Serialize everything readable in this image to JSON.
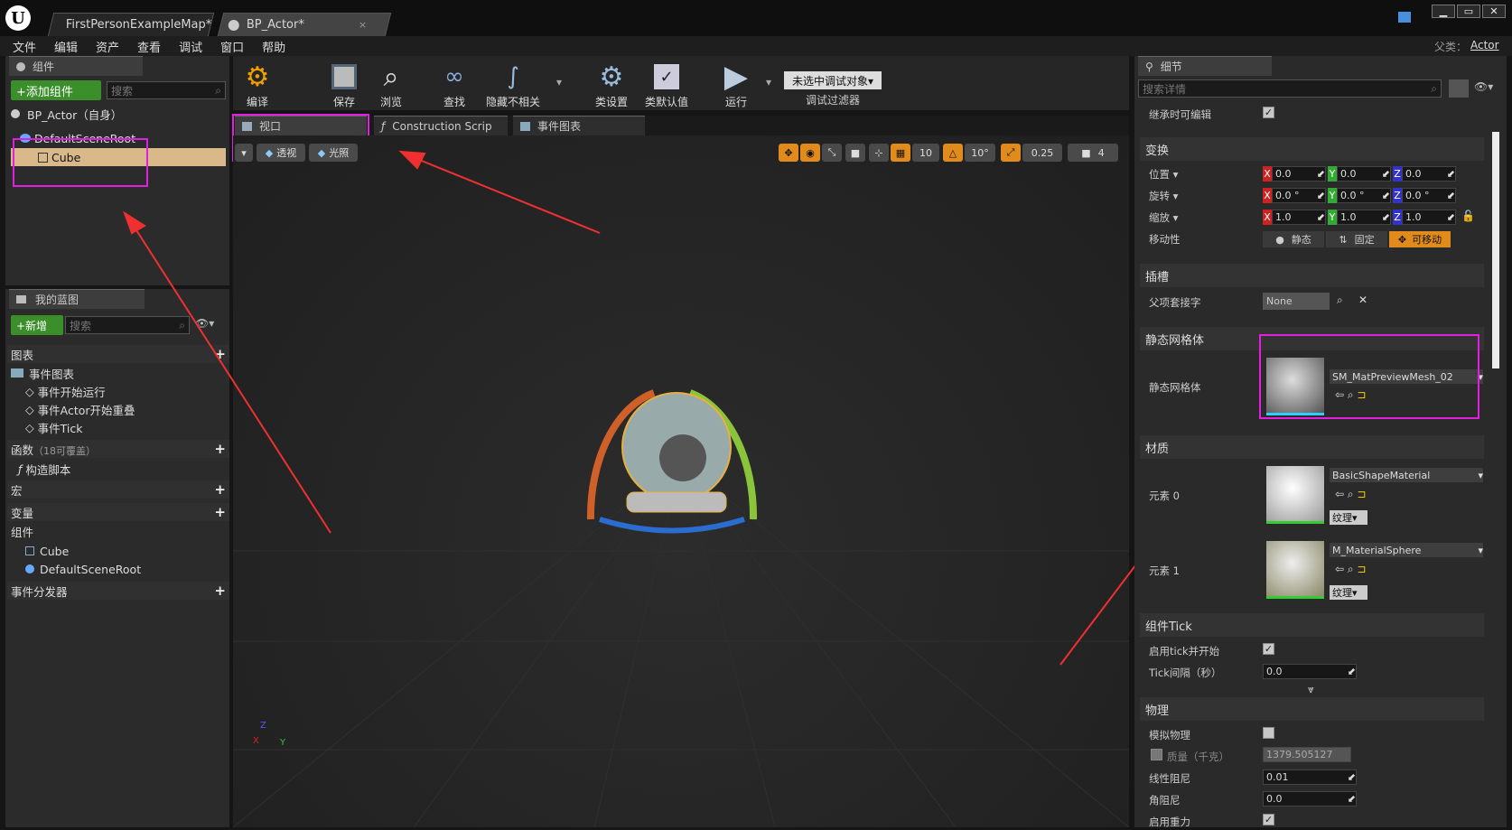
{
  "titlebar": {
    "tabs": [
      {
        "label": "FirstPersonExampleMap*"
      },
      {
        "label": "BP_Actor*"
      }
    ],
    "close_glyph": "×"
  },
  "menu": [
    "文件",
    "编辑",
    "资产",
    "查看",
    "调试",
    "窗口",
    "帮助"
  ],
  "parent": {
    "label": "父类：",
    "value": "Actor"
  },
  "components_panel": {
    "tab": "组件",
    "add_button": "+添加组件",
    "search_placeholder": "搜索",
    "self_item": "BP_Actor（自身）",
    "root_item": "DefaultSceneRoot",
    "child_item": "Cube"
  },
  "my_blueprint": {
    "tab": "我的蓝图",
    "new_button": "+新增",
    "search_placeholder": "搜索",
    "graph_cat": "图表",
    "event_graph": "事件图表",
    "events": [
      "事件开始运行",
      "事件Actor开始重叠",
      "事件Tick"
    ],
    "functions": "函数",
    "functions_note": "（18可覆盖）",
    "construct": "构造脚本",
    "macros": "宏",
    "variables": "变量",
    "components": "组件",
    "comp_items": [
      "Cube",
      "DefaultSceneRoot"
    ],
    "dispatchers": "事件分发器"
  },
  "toolbar": {
    "compile": "编译",
    "save": "保存",
    "browse": "浏览",
    "find": "查找",
    "hide": "隐藏不相关",
    "class_settings": "类设置",
    "class_defaults": "类默认值",
    "play": "运行",
    "debug_select": "未选中调试对象▾",
    "debug_filter": "调试过滤器"
  },
  "editor_tabs": [
    {
      "label": "视口"
    },
    {
      "label": "Construction Scrip"
    },
    {
      "label": "事件图表"
    }
  ],
  "viewport": {
    "perspective": "透视",
    "lit": "光照",
    "grid": "10",
    "rot": "10°",
    "scale": "0.25",
    "cam": "4",
    "axis_x": "X",
    "axis_y": "Y",
    "axis_z": "Z"
  },
  "details": {
    "tab": "细节",
    "search_placeholder": "搜索详情",
    "inherit_editable": "继承时可编辑",
    "transform": "变换",
    "location": "位置 ▾",
    "rotation": "旋转 ▾",
    "scale": "缩放 ▾",
    "mobility": "移动性",
    "loc": [
      "0.0",
      "0.0",
      "0.0"
    ],
    "rot": [
      "0.0 °",
      "0.0 °",
      "0.0 °"
    ],
    "scl": [
      "1.0",
      "1.0",
      "1.0"
    ],
    "mob_static": "静态",
    "mob_stationary": "固定",
    "mob_movable": "可移动",
    "sockets": "插槽",
    "parent_socket": "父项套接字",
    "socket_value": "None",
    "static_mesh_section": "静态网格体",
    "static_mesh": "静态网格体",
    "mesh_value": "SM_MatPreviewMesh_02",
    "materials": "材质",
    "elem0": "元素 0",
    "elem1": "元素 1",
    "mat0": "BasicShapeMaterial",
    "mat1": "M_MaterialSphere",
    "texture": "纹理▾",
    "tick_section": "组件Tick",
    "tick_enable": "启用tick并开始",
    "tick_interval": "Tick间隔（秒）",
    "tick_value": "0.0",
    "physics": "物理",
    "simulate": "模拟物理",
    "mass": "质量（千克）",
    "mass_value": "1379.505127",
    "linear_damp": "线性阻尼",
    "linear_value": "0.01",
    "angular_damp": "角阻尼",
    "angular_value": "0.0",
    "gravity": "启用重力"
  }
}
